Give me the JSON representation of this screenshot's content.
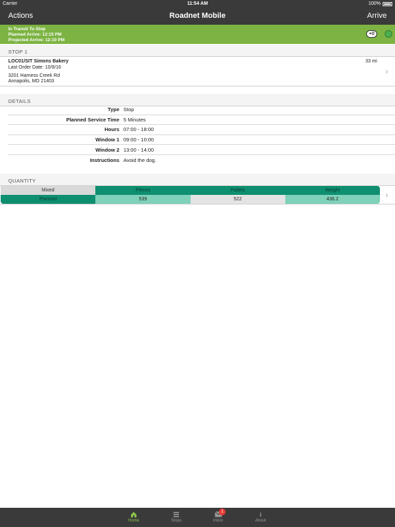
{
  "status": {
    "carrier": "Carrier",
    "time": "11:54 AM",
    "battery": "100%"
  },
  "nav": {
    "left": "Actions",
    "title": "Roadnet Mobile",
    "right": "Arrive"
  },
  "transit": {
    "line1": "In Transit To Stop",
    "line2": "Planned Arrive: 12:15 PM",
    "line3": "Projected Arrive: 12:10 PM",
    "pill": "+0"
  },
  "stop": {
    "header": "STOP 1",
    "name": "LOC01/SIT Simons Bakery",
    "last_order": "Last Order Date: 10/9/16",
    "address1": "3201 Harness Creek Rd",
    "address2": "Annapolis, MD 21403",
    "distance": "33 mi"
  },
  "details": {
    "header": "DETAILS",
    "rows": [
      {
        "label": "Type",
        "value": "Stop"
      },
      {
        "label": "Planned Service Time",
        "value": "5 Minutes"
      },
      {
        "label": "Hours",
        "value": "07:00 - 18:00"
      },
      {
        "label": "Window 1",
        "value": "09:00 - 10:00"
      },
      {
        "label": "Window 2",
        "value": "13:00 - 14:00"
      },
      {
        "label": "Instructions",
        "value": "Avoid the dog."
      }
    ]
  },
  "quantity": {
    "header": "QUANTITY",
    "columns": [
      "Mixed",
      "Pieces",
      "Pallets",
      "Weight"
    ],
    "row": [
      "Planned",
      "539",
      "522",
      "436.2"
    ]
  },
  "tabs": [
    {
      "label": "Home",
      "icon": "home-icon",
      "active": true
    },
    {
      "label": "Stops",
      "icon": "list-icon",
      "active": false
    },
    {
      "label": "Inbox",
      "icon": "mail-icon",
      "badge": "1",
      "active": false
    },
    {
      "label": "About",
      "icon": "info-icon",
      "active": false
    }
  ],
  "colors": {
    "accent": "#7cb342",
    "teal": "#0e8f70",
    "bar": "#3a3a3a"
  }
}
